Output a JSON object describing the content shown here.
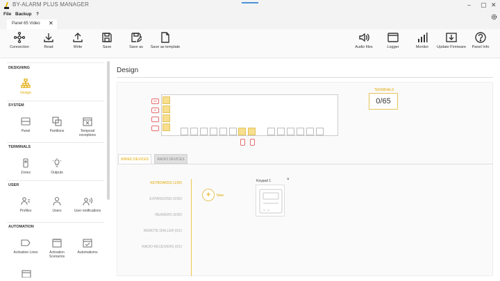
{
  "window": {
    "title": "BY-ALARM PLUS MANAGER",
    "minimize": "–",
    "maximize": "▢",
    "close": "✕"
  },
  "menu": [
    {
      "label": "File"
    },
    {
      "label": "Backup"
    },
    {
      "label": "?"
    }
  ],
  "tab": {
    "label": "Panel 65 Video",
    "close": "✕"
  },
  "toolbar": {
    "left": [
      {
        "label": "Connection",
        "icon": "connection-icon"
      },
      {
        "label": "Read",
        "icon": "download-icon"
      },
      {
        "label": "Write",
        "icon": "upload-icon"
      },
      {
        "label": "Save",
        "icon": "save-icon"
      },
      {
        "label": "Save as",
        "icon": "save-as-icon"
      },
      {
        "label": "Save as template",
        "icon": "template-icon"
      }
    ],
    "right": [
      {
        "label": "Audio files",
        "icon": "speaker-icon"
      },
      {
        "label": "Logger",
        "icon": "logger-icon"
      },
      {
        "label": "Monitor",
        "icon": "bar-chart-icon"
      },
      {
        "label": "Update Firmware",
        "icon": "firmware-icon"
      },
      {
        "label": "Panel Info",
        "icon": "help-icon"
      }
    ]
  },
  "sidebar": {
    "sections": [
      {
        "title": "DESIGNING",
        "items": [
          {
            "label": "Design",
            "icon": "design-icon",
            "active": true
          }
        ]
      },
      {
        "title": "SYSTEM",
        "items": [
          {
            "label": "Panel",
            "icon": "panel-icon"
          },
          {
            "label": "Partitions",
            "icon": "partitions-icon"
          },
          {
            "label": "Temporal exceptions",
            "icon": "calendar-x-icon"
          }
        ]
      },
      {
        "title": "TERMINALS",
        "items": [
          {
            "label": "Zones",
            "icon": "zones-icon"
          },
          {
            "label": "Outputs",
            "icon": "bulb-icon"
          }
        ]
      },
      {
        "title": "USER",
        "items": [
          {
            "label": "Profiles",
            "icon": "profiles-icon"
          },
          {
            "label": "Users",
            "icon": "users-icon"
          },
          {
            "label": "User notifications",
            "icon": "user-notify-icon"
          }
        ]
      },
      {
        "title": "AUTOMATION",
        "items": [
          {
            "label": "Activation Lines",
            "icon": "tag-icon"
          },
          {
            "label": "Activation Scenarios",
            "icon": "calendar-icon"
          },
          {
            "label": "Automatisms",
            "icon": "calendar-check-icon"
          }
        ]
      }
    ]
  },
  "main": {
    "title": "Design",
    "terminals": {
      "label": "TERMINALS",
      "value": "0/65"
    },
    "board_tags": [
      "SE",
      "SI",
      "",
      ""
    ],
    "device_tabs": [
      {
        "label": "WIRED DEVICES",
        "active": true
      },
      {
        "label": "RADIO DEVICES",
        "active": false
      }
    ],
    "categories": [
      {
        "label": "KEYBOARDS (1/20)",
        "active": true
      },
      {
        "label": "EXPANSIONS (0/30)",
        "active": false
      },
      {
        "label": "READERS (0/30)",
        "active": false
      },
      {
        "label": "REMOTE DIALLER (0/1)",
        "active": false
      },
      {
        "label": "RADIO RECEIVERS (0/1)",
        "active": false
      }
    ],
    "add": {
      "symbol": "+",
      "label": "New"
    },
    "device": {
      "name": "Keypad 1",
      "close": "×"
    }
  },
  "colors": {
    "accent": "#e0a800",
    "accent_fill": "#f7df8f",
    "alert": "#e46b6b"
  }
}
